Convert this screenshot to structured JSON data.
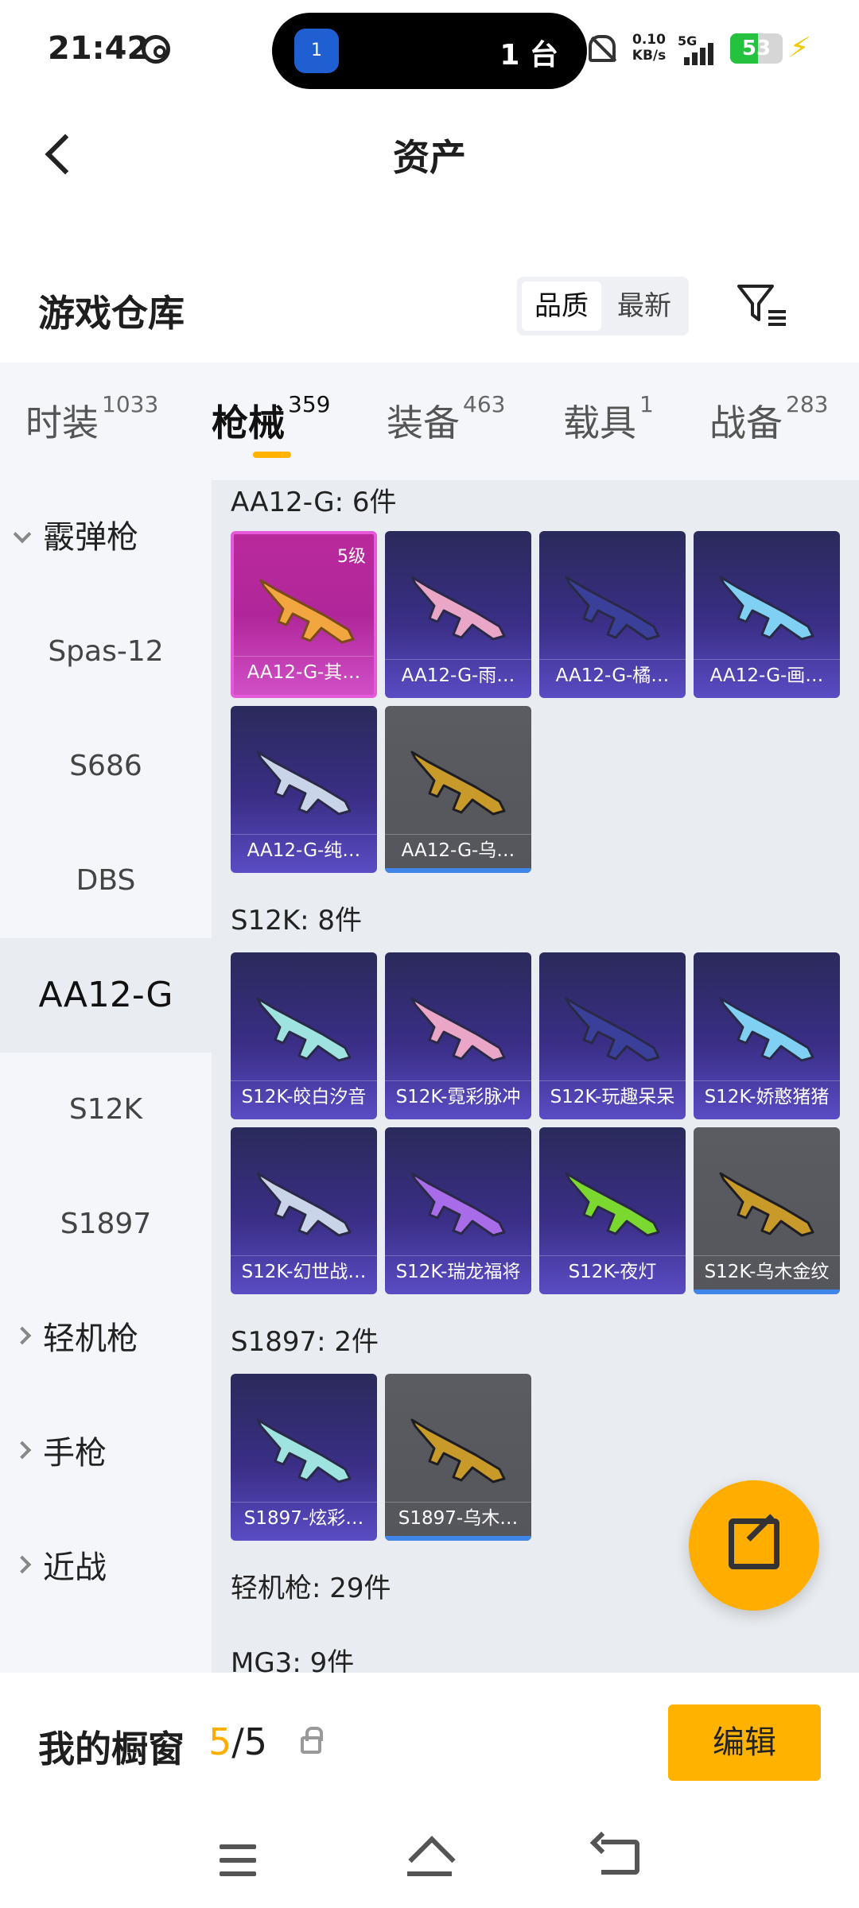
{
  "status_bar": {
    "time": "21:42",
    "island_app_badge": "1",
    "island_text": "1 台",
    "net_speed_value": "0.10",
    "net_speed_unit": "KB/s",
    "network_type": "5G",
    "battery_level": "53",
    "battery_fraction": 0.53
  },
  "header": {
    "title": "资产"
  },
  "warehouse": {
    "title": "游戏仓库",
    "sort_quality": "品质",
    "sort_newest": "最新"
  },
  "tabs": [
    {
      "label": "时装",
      "count": "1033"
    },
    {
      "label": "枪械",
      "count": "359"
    },
    {
      "label": "装备",
      "count": "463"
    },
    {
      "label": "载具",
      "count": "1"
    },
    {
      "label": "战备",
      "count": "283"
    }
  ],
  "sidebar": {
    "group_shotgun": "霰弹枪",
    "items": [
      "Spas-12",
      "S686",
      "DBS",
      "AA12-G",
      "S12K",
      "S1897"
    ],
    "group_lmg": "轻机枪",
    "group_pistol": "手枪",
    "group_melee": "近战"
  },
  "sections": {
    "aa12g": {
      "title": "AA12-G: 6件",
      "cards": [
        {
          "name": "AA12-G-其…",
          "level": "5级",
          "tier": "gold"
        },
        {
          "name": "AA12-G-雨…",
          "tier": "purple"
        },
        {
          "name": "AA12-G-橘…",
          "tier": "purple"
        },
        {
          "name": "AA12-G-画…",
          "tier": "purple"
        },
        {
          "name": "AA12-G-纯…",
          "tier": "purple"
        },
        {
          "name": "AA12-G-乌…",
          "tier": "gray"
        }
      ]
    },
    "s12k": {
      "title": "S12K: 8件",
      "cards": [
        {
          "name": "S12K-皎白汐音",
          "tier": "purple"
        },
        {
          "name": "S12K-霓彩脉冲",
          "tier": "purple"
        },
        {
          "name": "S12K-玩趣呆呆",
          "tier": "purple"
        },
        {
          "name": "S12K-娇憨猪猪",
          "tier": "purple"
        },
        {
          "name": "S12K-幻世战…",
          "tier": "purple"
        },
        {
          "name": "S12K-瑞龙福将",
          "tier": "purple"
        },
        {
          "name": "S12K-夜灯",
          "tier": "purple"
        },
        {
          "name": "S12K-乌木金纹",
          "tier": "gray"
        }
      ]
    },
    "s1897": {
      "title": "S1897: 2件",
      "cards": [
        {
          "name": "S1897-炫彩…",
          "tier": "purple"
        },
        {
          "name": "S1897-乌木…",
          "tier": "gray"
        }
      ]
    },
    "lmg_title": "轻机枪: 29件",
    "mg3_title": "MG3: 9件"
  },
  "bottom": {
    "showcase_label": "我的橱窗",
    "showcase_current": "5",
    "showcase_total": "/5",
    "edit_label": "编辑"
  },
  "colors": {
    "accent": "#ffb300",
    "gold_card": "#b92a9c",
    "purple_card": "#3a2e86",
    "gray_card": "#55565c"
  }
}
